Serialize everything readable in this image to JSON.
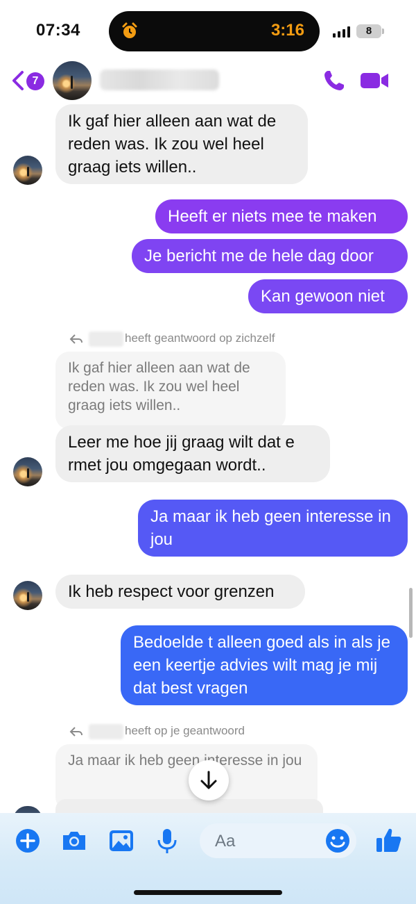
{
  "status_bar": {
    "time": "07:34",
    "timer": "3:16",
    "battery": "8"
  },
  "header": {
    "unread_count": "7"
  },
  "messages": {
    "m1": "Ik gaf hier alleen aan wat de reden was.   Ik zou wel heel graag iets willen..",
    "m2": "Heeft er niets mee te maken",
    "m3": "Je bericht me de hele dag door",
    "m4": "Kan gewoon niet",
    "reply1_label": "heeft geantwoord op zichzelf",
    "reply1_quote": "Ik gaf hier alleen aan wat de reden was.   Ik zou wel heel graag iets willen..",
    "m5": "Leer me hoe jij graag wilt dat e rmet jou omgegaan wordt..",
    "m6": "Ja maar ik heb geen interesse in jou",
    "m7": "Ik heb respect voor grenzen",
    "m8": "Bedoelde t alleen goed als in als je een keertje advies wilt mag je mij dat best vragen",
    "reply2_label": "heeft op je geantwoord",
    "reply2_quote": "Ja maar ik heb geen interesse in jou"
  },
  "composer": {
    "placeholder": "Aa"
  },
  "icons": {
    "back": "chevron-left-icon",
    "phone": "phone-icon",
    "video": "video-camera-icon",
    "plus": "plus-circle-icon",
    "camera": "camera-icon",
    "gallery": "image-icon",
    "mic": "microphone-icon",
    "emoji": "emoji-icon",
    "like": "thumbs-up-icon",
    "scroll": "arrow-down-icon",
    "alarm": "alarm-clock-icon"
  },
  "colors": {
    "accent": "#8a2be2",
    "out_top": "#8a3cf0",
    "out_bottom": "#2f6bf5",
    "incoming": "#eeeeee"
  }
}
